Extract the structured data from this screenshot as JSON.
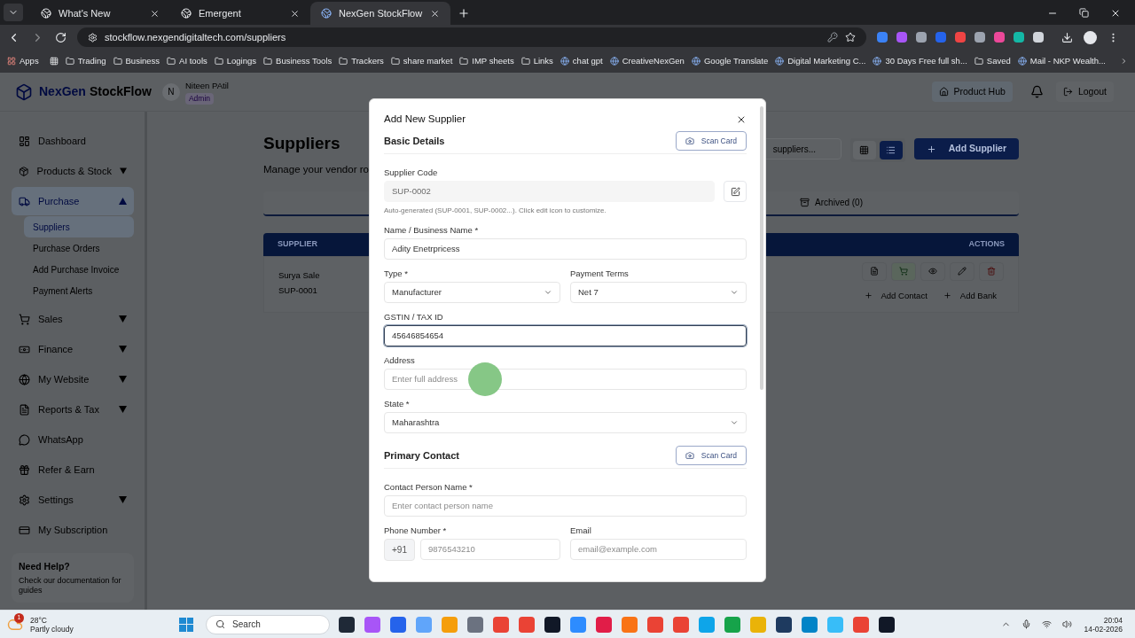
{
  "browser": {
    "tabs": [
      {
        "title": "What's New",
        "selected": false
      },
      {
        "title": "Emergent",
        "selected": false
      },
      {
        "title": "NexGen StockFlow",
        "selected": true
      }
    ],
    "url": "stockflow.nexgendigitaltech.com/suppliers",
    "bookmarks": [
      {
        "label": "Apps",
        "kind": "apps"
      },
      {
        "label": "Trading",
        "kind": "folder"
      },
      {
        "label": "Business",
        "kind": "folder"
      },
      {
        "label": "AI tools",
        "kind": "folder"
      },
      {
        "label": "Logings",
        "kind": "folder"
      },
      {
        "label": "Business Tools",
        "kind": "folder"
      },
      {
        "label": "Trackers",
        "kind": "folder"
      },
      {
        "label": "share market",
        "kind": "folder"
      },
      {
        "label": "IMP sheets",
        "kind": "folder"
      },
      {
        "label": "Links",
        "kind": "folder"
      },
      {
        "label": "chat gpt",
        "kind": "site"
      },
      {
        "label": "CreativeNexGen",
        "kind": "site"
      },
      {
        "label": "Google Translate",
        "kind": "site"
      },
      {
        "label": "Digital Marketing C...",
        "kind": "site"
      },
      {
        "label": "30 Days Free full sh...",
        "kind": "site"
      },
      {
        "label": "Saved",
        "kind": "folder"
      },
      {
        "label": "Mail - NKP Wealth...",
        "kind": "site"
      }
    ]
  },
  "app": {
    "brand": {
      "first": "NexGen",
      "second": "StockFlow"
    },
    "user": {
      "initial": "N",
      "name": "Niteen PAtil",
      "role": "Admin"
    },
    "header_actions": {
      "product_hub": "Product Hub",
      "logout": "Logout"
    },
    "sidebar": {
      "items": [
        {
          "label": "Dashboard",
          "selected": false
        },
        {
          "label": "Products & Stock",
          "selected": false,
          "expanded": false
        },
        {
          "label": "Purchase",
          "selected": true,
          "expanded": true,
          "children": [
            {
              "label": "Suppliers",
              "selected": true
            },
            {
              "label": "Purchase Orders",
              "selected": false
            },
            {
              "label": "Add Purchase Invoice",
              "selected": false
            },
            {
              "label": "Payment Alerts",
              "selected": false
            }
          ]
        },
        {
          "label": "Sales",
          "selected": false,
          "expanded": false
        },
        {
          "label": "Finance",
          "selected": false,
          "expanded": false
        },
        {
          "label": "My Website",
          "selected": false,
          "expanded": false
        },
        {
          "label": "Reports & Tax",
          "selected": false,
          "expanded": false
        },
        {
          "label": "WhatsApp",
          "selected": false
        },
        {
          "label": "Refer & Earn",
          "selected": false
        },
        {
          "label": "Settings",
          "selected": false,
          "expanded": false
        },
        {
          "label": "My Subscription",
          "selected": false
        }
      ],
      "help": {
        "title": "Need Help?",
        "text": "Check our documentation for guides"
      }
    },
    "main": {
      "title": "Suppliers",
      "subtitle": "Manage your vendor ro",
      "search": {
        "placeholder": "suppliers..."
      },
      "view_toggle": [
        {
          "kind": "grid",
          "selected": false
        },
        {
          "kind": "list",
          "selected": true
        }
      ],
      "add_button": "Add Supplier",
      "filter_tabs": [
        {
          "label": "Archived (0)"
        }
      ],
      "table": {
        "columns": [
          "SUPPLIER",
          "ACTIONS"
        ],
        "rows": [
          {
            "name": "Surya Sale",
            "code": "SUP-0001",
            "links": [
              "Add Contact",
              "Add Bank"
            ]
          }
        ]
      }
    }
  },
  "modal": {
    "title": "Add New Supplier",
    "sections": [
      {
        "heading": "Basic Details",
        "scan_button": "Scan Card",
        "rows": [
          [
            {
              "label": "Supplier Code",
              "kind": "locked",
              "value": "SUP-0002",
              "hint": "Auto-generated (SUP-0001, SUP-0002...). Click edit icon to customize."
            }
          ],
          [
            {
              "label": "Name / Business Name *",
              "kind": "text",
              "value": "Adity Enetrpricess",
              "focused": false
            }
          ],
          [
            {
              "label": "Type *",
              "kind": "select",
              "value": "Manufacturer"
            },
            {
              "label": "Payment Terms",
              "kind": "select",
              "value": "Net 7"
            }
          ],
          [
            {
              "label": "GSTIN / TAX ID",
              "kind": "text",
              "value": "45646854654",
              "focused": true
            }
          ],
          [
            {
              "label": "Address",
              "kind": "text",
              "placeholder": "Enter full address",
              "focused": false
            }
          ],
          [
            {
              "label": "State *",
              "kind": "select",
              "value": "Maharashtra"
            }
          ]
        ]
      },
      {
        "heading": "Primary Contact",
        "scan_button": "Scan Card",
        "rows": [
          [
            {
              "label": "Contact Person Name *",
              "kind": "text",
              "placeholder": "Enter contact person name",
              "focused": false
            }
          ],
          [
            {
              "label": "Phone Number *",
              "kind": "phone",
              "prefix": "+91",
              "placeholder": "9876543210"
            },
            {
              "label": "Email",
              "kind": "text",
              "placeholder": "email@example.com",
              "focused": false
            }
          ]
        ]
      }
    ]
  },
  "taskbar": {
    "weather": {
      "badge": "1",
      "temp": "28°C",
      "text": "Partly cloudy"
    },
    "search": "Search",
    "clock": {
      "time": "20:04",
      "date": "14-02-2026"
    }
  }
}
